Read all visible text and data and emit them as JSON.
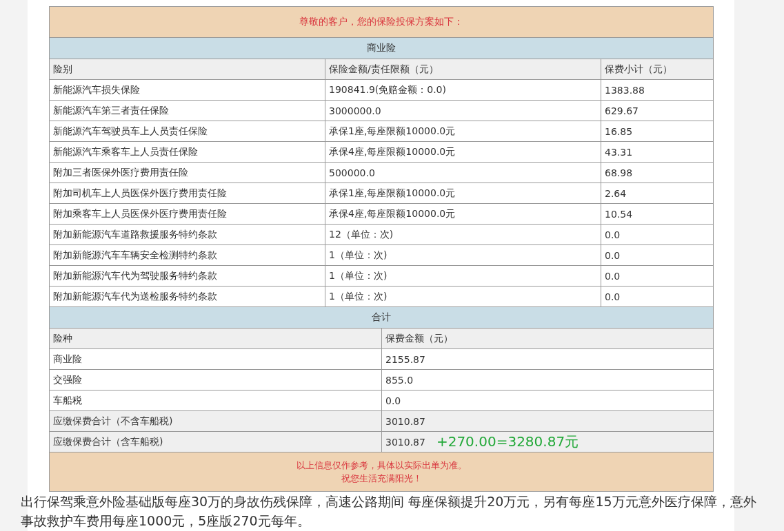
{
  "header": "尊敬的客户，您的保险投保方案如下：",
  "commercial": {
    "title": "商业险",
    "columns": [
      "险别",
      "保险金额/责任限额（元）",
      "保费小计（元）"
    ],
    "rows": [
      [
        "新能源汽车损失保险",
        "190841.9(免赔金额：0.0)",
        "1383.88"
      ],
      [
        "新能源汽车第三者责任保险",
        "3000000.0",
        "629.67"
      ],
      [
        "新能源汽车驾驶员车上人员责任保险",
        "承保1座,每座限额10000.0元",
        "16.85"
      ],
      [
        "新能源汽车乘客车上人员责任保险",
        "承保4座,每座限额10000.0元",
        "43.31"
      ],
      [
        "附加三者医保外医疗费用责任险",
        "500000.0",
        "68.98"
      ],
      [
        "附加司机车上人员医保外医疗费用责任险",
        "承保1座,每座限额10000.0元",
        "2.64"
      ],
      [
        "附加乘客车上人员医保外医疗费用责任险",
        "承保4座,每座限额10000.0元",
        "10.54"
      ],
      [
        "附加新能源汽车道路救援服务特约条款",
        "12（单位：次)",
        "0.0"
      ],
      [
        "附加新能源汽车车辆安全检测特约条款",
        "1（单位：次)",
        "0.0"
      ],
      [
        "附加新能源汽车代为驾驶服务特约条款",
        "1（单位：次)",
        "0.0"
      ],
      [
        "附加新能源汽车代为送检服务特约条款",
        "1（单位：次)",
        "0.0"
      ]
    ]
  },
  "totals": {
    "title": "合计",
    "columns": [
      "险种",
      "保费金额（元）"
    ],
    "rows": [
      {
        "cells": [
          "商业险",
          "2155.87"
        ],
        "highlighted": false
      },
      {
        "cells": [
          "交强险",
          "855.0"
        ],
        "highlighted": false
      },
      {
        "cells": [
          "车船税",
          "0.0"
        ],
        "highlighted": false
      },
      {
        "cells": [
          "应缴保费合计（不含车船税)",
          "3010.87"
        ],
        "highlighted": true
      },
      {
        "cells": [
          "应缴保费合计（含车船税)",
          "3010.87"
        ],
        "highlighted": true,
        "note": "+270.00=3280.87元"
      }
    ]
  },
  "footer": [
    "以上信息仅作参考，具体以实际出单为准。",
    "祝您生活充满阳光！"
  ],
  "caption": "出行保驾乘意外险基础版每座30万的身故伤残保障，高速公路期间 每座保额提升20万元，另有每座15万元意外医疗保障，意外事故救护车费用每座1000元，5座版270元每年。"
}
